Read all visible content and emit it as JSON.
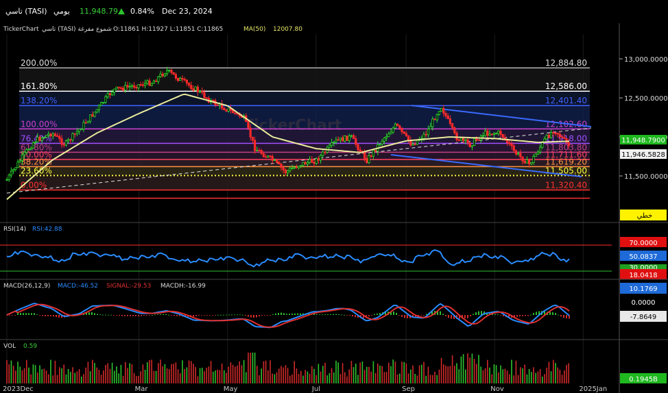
{
  "topbar": {
    "symbol": "تاسي (TASI)",
    "interval": "يومي",
    "price": "11,948.79",
    "change_pct": "0.84%",
    "date": "Dec 23, 2024"
  },
  "header": {
    "brand": "TickerChart",
    "title": "تاسي (TASI) شموع مفرغة",
    "ohlc": "O:11861  H:11927  L:11851  C:11865",
    "ma_label": "MA(50)",
    "ma_value": "12007.80",
    "watermark": "TickerChart"
  },
  "fibonacci": [
    {
      "pct": "200.00%",
      "value": "12,884.80",
      "level": 12884.8,
      "color": "#b0b0b0"
    },
    {
      "pct": "161.80%",
      "value": "12,586.00",
      "level": 12586.0,
      "color": "#ffffff"
    },
    {
      "pct": "138.20%",
      "value": "12,401.40",
      "level": 12401.4,
      "color": "#4060ff"
    },
    {
      "pct": "100.00%",
      "value": "12,102.60",
      "level": 12102.6,
      "color": "#d040d0"
    },
    {
      "pct": "76.40%",
      "value": "11,918.00",
      "level": 11918.0,
      "color": "#a050ff"
    },
    {
      "pct": "61.80%",
      "value": "11,803.80",
      "level": 11803.8,
      "color": "#c04080"
    },
    {
      "pct": "50.00%",
      "value": "11,711.60",
      "level": 11711.6,
      "color": "#ff4060"
    },
    {
      "pct": "38.20%",
      "value": "11,619.20",
      "level": 11619.2,
      "color": "#ff9040"
    },
    {
      "pct": "23.60%",
      "value": "11,505.00",
      "level": 11505.0,
      "color": "#ffff40"
    },
    {
      "pct": "0.00%",
      "value": "11,320.40",
      "level": 11320.4,
      "color": "#ff3030"
    }
  ],
  "price_axis": {
    "ticks": [
      "13,000.0000",
      "12,500.0000",
      "12,000.0000",
      "11,500.0000"
    ],
    "tick_values": [
      13000,
      12500,
      12000,
      11500
    ],
    "last_price": "11,948.7900",
    "ma_price": "11,946.5828",
    "scale_button": "خطي"
  },
  "rsi": {
    "label": "RSI(14)",
    "value_label": "RSI:42.88",
    "levels": [
      "70.0000",
      "50.0837",
      "30.0000",
      "18.0418"
    ]
  },
  "macd": {
    "label": "MACD(26,12,9)",
    "macd_label": "MACD:-46.52",
    "signal_label": "SIGNAL:-29.53",
    "hist_label": "MACDH:-16.99",
    "levels": [
      "10.1769",
      "0.0000",
      "-7.8649"
    ]
  },
  "volume": {
    "label": "VOL",
    "value_label": "0.59",
    "level": "0.1945B"
  },
  "time_axis": {
    "labels": [
      "2023Dec",
      "Mar",
      "May",
      "Jul",
      "Sep",
      "Nov",
      "2025Jan"
    ]
  },
  "chart_data": {
    "type": "line",
    "title": "تاسي (TASI)",
    "x_range": [
      "2023-12-01",
      "2025-01-15"
    ],
    "ylim": [
      11200,
      13100
    ],
    "series": [
      {
        "name": "TASI",
        "points": [
          [
            "2023-12-01",
            11450
          ],
          [
            "2023-12-10",
            11700
          ],
          [
            "2023-12-20",
            11950
          ],
          [
            "2024-01-01",
            12050
          ],
          [
            "2024-01-10",
            11900
          ],
          [
            "2024-01-20",
            12100
          ],
          [
            "2024-02-01",
            12350
          ],
          [
            "2024-02-12",
            12600
          ],
          [
            "2024-02-25",
            12650
          ],
          [
            "2024-03-10",
            12700
          ],
          [
            "2024-03-20",
            12850
          ],
          [
            "2024-04-01",
            12700
          ],
          [
            "2024-04-10",
            12600
          ],
          [
            "2024-04-20",
            12450
          ],
          [
            "2024-05-01",
            12350
          ],
          [
            "2024-05-12",
            12250
          ],
          [
            "2024-05-20",
            11850
          ],
          [
            "2024-06-01",
            11700
          ],
          [
            "2024-06-10",
            11550
          ],
          [
            "2024-06-20",
            11650
          ],
          [
            "2024-07-01",
            11700
          ],
          [
            "2024-07-15",
            11950
          ],
          [
            "2024-07-25",
            12000
          ],
          [
            "2024-08-05",
            11700
          ],
          [
            "2024-08-15",
            11950
          ],
          [
            "2024-08-25",
            12150
          ],
          [
            "2024-09-05",
            11900
          ],
          [
            "2024-09-15",
            12050
          ],
          [
            "2024-09-25",
            12400
          ],
          [
            "2024-10-05",
            12000
          ],
          [
            "2024-10-15",
            11900
          ],
          [
            "2024-10-25",
            12050
          ],
          [
            "2024-11-05",
            12050
          ],
          [
            "2024-11-15",
            11800
          ],
          [
            "2024-11-25",
            11650
          ],
          [
            "2024-12-05",
            11950
          ],
          [
            "2024-12-12",
            12100
          ],
          [
            "2024-12-23",
            11865
          ]
        ]
      },
      {
        "name": "MA(50)",
        "points": [
          [
            "2023-12-01",
            11200
          ],
          [
            "2024-01-01",
            11700
          ],
          [
            "2024-02-01",
            12050
          ],
          [
            "2024-03-01",
            12300
          ],
          [
            "2024-04-01",
            12550
          ],
          [
            "2024-05-01",
            12400
          ],
          [
            "2024-06-01",
            12000
          ],
          [
            "2024-07-01",
            11850
          ],
          [
            "2024-08-01",
            11800
          ],
          [
            "2024-09-01",
            11950
          ],
          [
            "2024-10-01",
            12000
          ],
          [
            "2024-11-01",
            11980
          ],
          [
            "2024-12-01",
            11930
          ],
          [
            "2024-12-23",
            11946
          ]
        ]
      }
    ]
  }
}
